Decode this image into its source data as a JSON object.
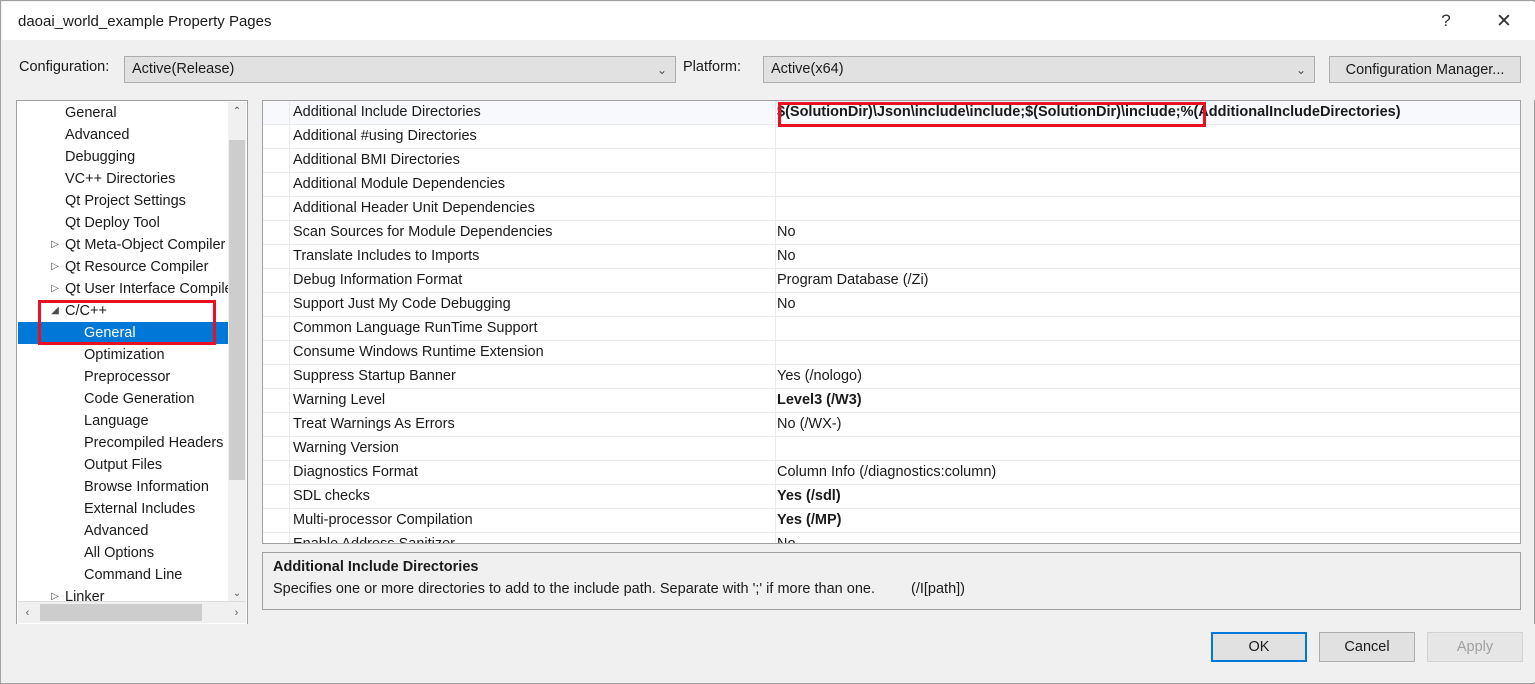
{
  "window": {
    "title": "daoai_world_example Property Pages",
    "help_icon": "?",
    "close_icon": "✕"
  },
  "toolbar": {
    "configuration_label": "Configuration:",
    "configuration_value": "Active(Release)",
    "platform_label": "Platform:",
    "platform_value": "Active(x64)",
    "configuration_manager_label": "Configuration Manager...",
    "dropdown_icon": "⌄"
  },
  "tree": {
    "selected": "General",
    "scroll_icons": {
      "up": "⌃",
      "down": "⌄",
      "left": "‹",
      "right": "›"
    },
    "items": [
      {
        "label": "General",
        "level": 1,
        "arrow": "",
        "selected": false
      },
      {
        "label": "Advanced",
        "level": 1,
        "arrow": "",
        "selected": false
      },
      {
        "label": "Debugging",
        "level": 1,
        "arrow": "",
        "selected": false
      },
      {
        "label": "VC++ Directories",
        "level": 1,
        "arrow": "",
        "selected": false
      },
      {
        "label": "Qt Project Settings",
        "level": 1,
        "arrow": "",
        "selected": false
      },
      {
        "label": "Qt Deploy Tool",
        "level": 1,
        "arrow": "",
        "selected": false
      },
      {
        "label": "Qt Meta-Object Compiler",
        "level": 1,
        "arrow": "▷",
        "selected": false
      },
      {
        "label": "Qt Resource Compiler",
        "level": 1,
        "arrow": "▷",
        "selected": false
      },
      {
        "label": "Qt User Interface Compiler",
        "level": 1,
        "arrow": "▷",
        "selected": false
      },
      {
        "label": "C/C++",
        "level": 1,
        "arrow": "◢",
        "selected": false
      },
      {
        "label": "General",
        "level": 2,
        "arrow": "",
        "selected": true
      },
      {
        "label": "Optimization",
        "level": 2,
        "arrow": "",
        "selected": false
      },
      {
        "label": "Preprocessor",
        "level": 2,
        "arrow": "",
        "selected": false
      },
      {
        "label": "Code Generation",
        "level": 2,
        "arrow": "",
        "selected": false
      },
      {
        "label": "Language",
        "level": 2,
        "arrow": "",
        "selected": false
      },
      {
        "label": "Precompiled Headers",
        "level": 2,
        "arrow": "",
        "selected": false
      },
      {
        "label": "Output Files",
        "level": 2,
        "arrow": "",
        "selected": false
      },
      {
        "label": "Browse Information",
        "level": 2,
        "arrow": "",
        "selected": false
      },
      {
        "label": "External Includes",
        "level": 2,
        "arrow": "",
        "selected": false
      },
      {
        "label": "Advanced",
        "level": 2,
        "arrow": "",
        "selected": false
      },
      {
        "label": "All Options",
        "level": 2,
        "arrow": "",
        "selected": false
      },
      {
        "label": "Command Line",
        "level": 2,
        "arrow": "",
        "selected": false
      },
      {
        "label": "Linker",
        "level": 1,
        "arrow": "▷",
        "selected": false
      }
    ]
  },
  "grid": {
    "rows": [
      {
        "name": "Additional Include Directories",
        "value": "$(SolutionDir)\\Json\\include\\include;$(SolutionDir)\\include;%(AdditionalIncludeDirectories)",
        "bold": true,
        "selected": true
      },
      {
        "name": "Additional #using Directories",
        "value": "",
        "bold": false,
        "selected": false
      },
      {
        "name": "Additional BMI Directories",
        "value": "",
        "bold": false,
        "selected": false
      },
      {
        "name": "Additional Module Dependencies",
        "value": "",
        "bold": false,
        "selected": false
      },
      {
        "name": "Additional Header Unit Dependencies",
        "value": "",
        "bold": false,
        "selected": false
      },
      {
        "name": "Scan Sources for Module Dependencies",
        "value": "No",
        "bold": false,
        "selected": false
      },
      {
        "name": "Translate Includes to Imports",
        "value": "No",
        "bold": false,
        "selected": false
      },
      {
        "name": "Debug Information Format",
        "value": "Program Database (/Zi)",
        "bold": false,
        "selected": false
      },
      {
        "name": "Support Just My Code Debugging",
        "value": "No",
        "bold": false,
        "selected": false
      },
      {
        "name": "Common Language RunTime Support",
        "value": "",
        "bold": false,
        "selected": false
      },
      {
        "name": "Consume Windows Runtime Extension",
        "value": "",
        "bold": false,
        "selected": false
      },
      {
        "name": "Suppress Startup Banner",
        "value": "Yes (/nologo)",
        "bold": false,
        "selected": false
      },
      {
        "name": "Warning Level",
        "value": "Level3 (/W3)",
        "bold": true,
        "selected": false
      },
      {
        "name": "Treat Warnings As Errors",
        "value": "No (/WX-)",
        "bold": false,
        "selected": false
      },
      {
        "name": "Warning Version",
        "value": "",
        "bold": false,
        "selected": false
      },
      {
        "name": "Diagnostics Format",
        "value": "Column Info (/diagnostics:column)",
        "bold": false,
        "selected": false
      },
      {
        "name": "SDL checks",
        "value": "Yes (/sdl)",
        "bold": true,
        "selected": false
      },
      {
        "name": "Multi-processor Compilation",
        "value": "Yes (/MP)",
        "bold": true,
        "selected": false
      },
      {
        "name": "Enable Address Sanitizer",
        "value": "No",
        "bold": false,
        "selected": false
      }
    ]
  },
  "description": {
    "title": "Additional Include Directories",
    "text": "Specifies one or more directories to add to the include path. Separate with ';' if more than one.",
    "switch": "(/I[path])"
  },
  "footer": {
    "ok_label": "OK",
    "cancel_label": "Cancel",
    "apply_label": "Apply"
  },
  "annotations": {
    "accent_red": "#e81123",
    "selection_blue": "#0078d7"
  }
}
